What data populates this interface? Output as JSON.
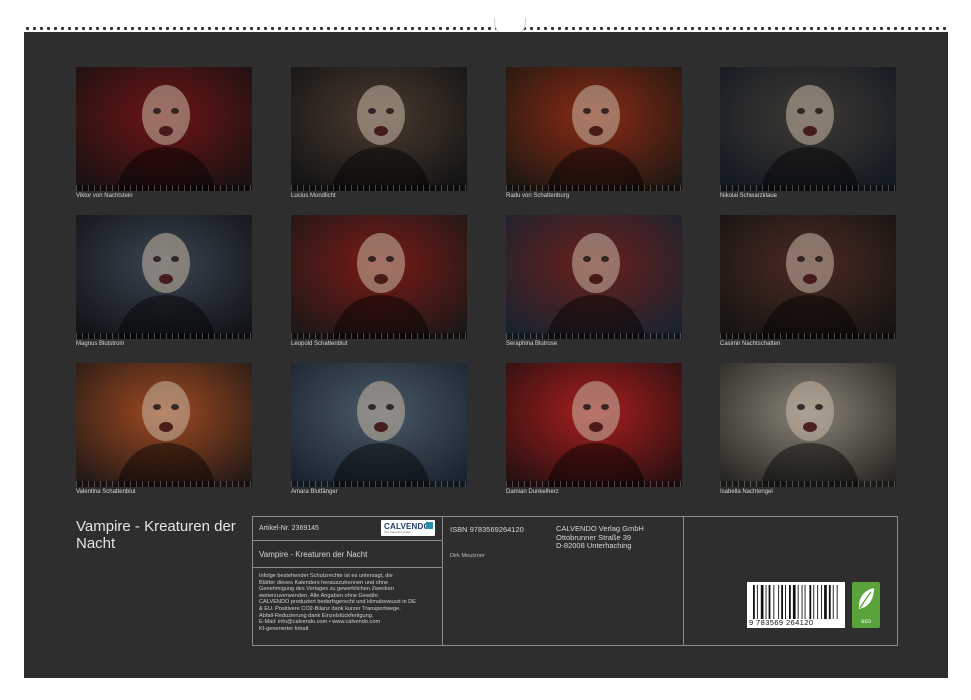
{
  "calendar": {
    "title": "Vampire - Kreaturen der Nacht",
    "article_label": "Artikel-Nr. 2369145",
    "subtitle": "Vampire - Kreaturen der Nacht",
    "isbn": "ISBN 9783569264120",
    "author": "Dirk Meutzner",
    "publisher": "CALVENDO Verlag GmbH\nOttobrunner Straße 39\nD-82008 Unterhaching",
    "legal_text": "Infolge bestehender Schutzrechte ist es untersagt, die\nBlätter dieses Kalenders herauszutrennen und ohne\nGenehmigung des Verlages zu gewerblichen Zwecken\nweiterzuverwenden. Alle Angaben ohne Gewähr.\nCALVENDO produziert bedarfsgerecht und klimabewusst in DE\n& EU. Positivere CO2-Bilanz dank kurzer Transportwege.\nAbfall-Reduzierung dank Einzelstückfertigung.\nE-Mail: info@calvendo.com • www.calvendo.com\nKI-generierter Inhalt",
    "logo_text": "CALVENDO",
    "logo_tagline": "Ihre Kalendervielfalt",
    "barcode_digits": "9 783569 264120",
    "eco_label": "eco"
  },
  "thumbnails": [
    {
      "caption": "Viktor von Nachtstein",
      "c1": "#6e1414",
      "c2": "#1a1212"
    },
    {
      "caption": "Lucius Mondlicht",
      "c1": "#4a3a2e",
      "c2": "#141414"
    },
    {
      "caption": "Radu von Schattenburg",
      "c1": "#8a2a14",
      "c2": "#201812"
    },
    {
      "caption": "Nikolai Schwarzklaue",
      "c1": "#3e3a34",
      "c2": "#141a22"
    },
    {
      "caption": "Magnus Blutstrom",
      "c1": "#3a4450",
      "c2": "#121418"
    },
    {
      "caption": "Leopold Schattenblut",
      "c1": "#7a1a16",
      "c2": "#1c1816"
    },
    {
      "caption": "Seraphina Blutrose",
      "c1": "#6a2018",
      "c2": "#1a2230"
    },
    {
      "caption": "Casimir Nachtschatten",
      "c1": "#4a2a22",
      "c2": "#161412"
    },
    {
      "caption": "Valentina Schattenblut",
      "c1": "#a04a20",
      "c2": "#241a16"
    },
    {
      "caption": "Amara Blutfänger",
      "c1": "#4a5a66",
      "c2": "#1a2430"
    },
    {
      "caption": "Damian Dunkelherz",
      "c1": "#a81e1e",
      "c2": "#2a1010"
    },
    {
      "caption": "Isabella Nachtengel",
      "c1": "#8a8478",
      "c2": "#2a2824"
    }
  ]
}
